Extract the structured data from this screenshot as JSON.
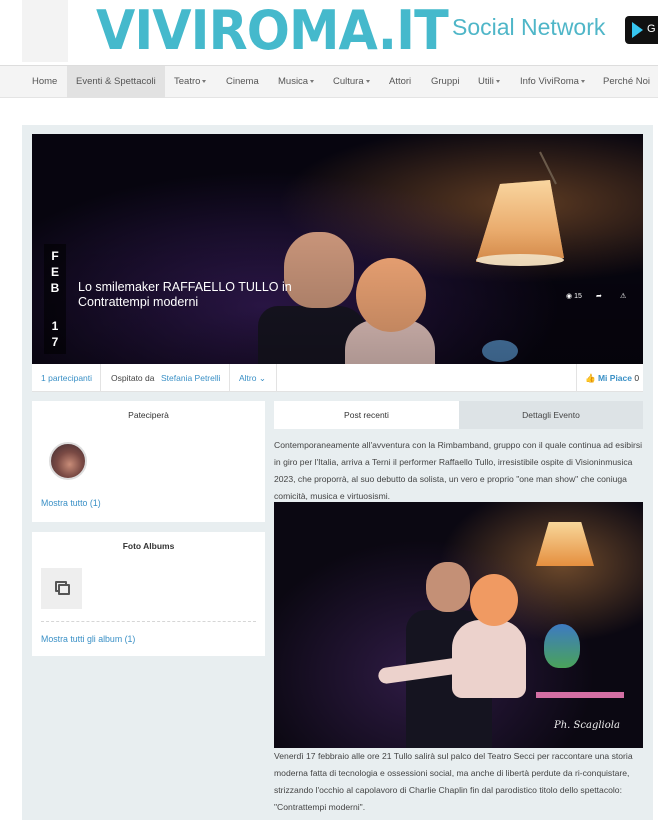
{
  "header": {
    "logo": "VIVIROMA.IT",
    "tagline": "Social Network",
    "store_badge_glyph": "G"
  },
  "nav": {
    "items": [
      {
        "label": "Home"
      },
      {
        "label": "Eventi & Spettacoli",
        "active": true
      },
      {
        "label": "Teatro",
        "dropdown": true
      },
      {
        "label": "Cinema"
      },
      {
        "label": "Musica",
        "dropdown": true
      },
      {
        "label": "Cultura",
        "dropdown": true
      },
      {
        "label": "Attori"
      },
      {
        "label": "Gruppi"
      },
      {
        "label": "Utili",
        "dropdown": true
      },
      {
        "label": "Info ViviRoma",
        "dropdown": true
      },
      {
        "label": "Perché Noi"
      }
    ]
  },
  "event": {
    "date_month": [
      "F",
      "E",
      "B"
    ],
    "date_day": [
      "1",
      "7"
    ],
    "title": "Lo smilemaker RAFFAELLO TULLO in Contrattempi moderni",
    "views": "15",
    "participants": "1 partecipanti",
    "hosted_by_label": "Ospitato da",
    "host": "Stefania Petrelli",
    "more": "Altro",
    "like_label": "Mi Piace",
    "like_count": "0"
  },
  "sidebar": {
    "participate": {
      "title": "Pateciperà",
      "show_all": "Mostra tutto (1)"
    },
    "albums": {
      "title": "Foto Albums",
      "show_all": "Mostra tutti gli album (1)"
    }
  },
  "tabs": {
    "recent_posts": "Post recenti",
    "event_details": "Dettagli Evento"
  },
  "post": {
    "paragraph1": "Contemporaneamente all'avventura con la Rimbamband, gruppo con il quale continua ad esibirsi in giro per l'Italia, arriva a Terni il performer Raffaello Tullo, irresistibile ospite di Visioninmusica 2023, che proporrà, al suo debutto da solista, un vero e proprio \"one man show\" che coniuga comicità, musica e virtuosismi.",
    "photo_signature": "Ph. Scagliola",
    "paragraph2": "Venerdì 17 febbraio alle ore 21 Tullo salirà sul palco del Teatro Secci per raccontare una storia moderna fatta di tecnologia e ossessioni social, ma anche di libertà perdute da ri-conquistare, strizzando l'occhio al capolavoro di Charlie Chaplin fin dal parodistico titolo dello spettacolo: \"Contrattempi moderni\"."
  },
  "colors": {
    "brand": "#45b9cc",
    "link": "#3a90c6",
    "panel_bg": "#e8eef0"
  }
}
